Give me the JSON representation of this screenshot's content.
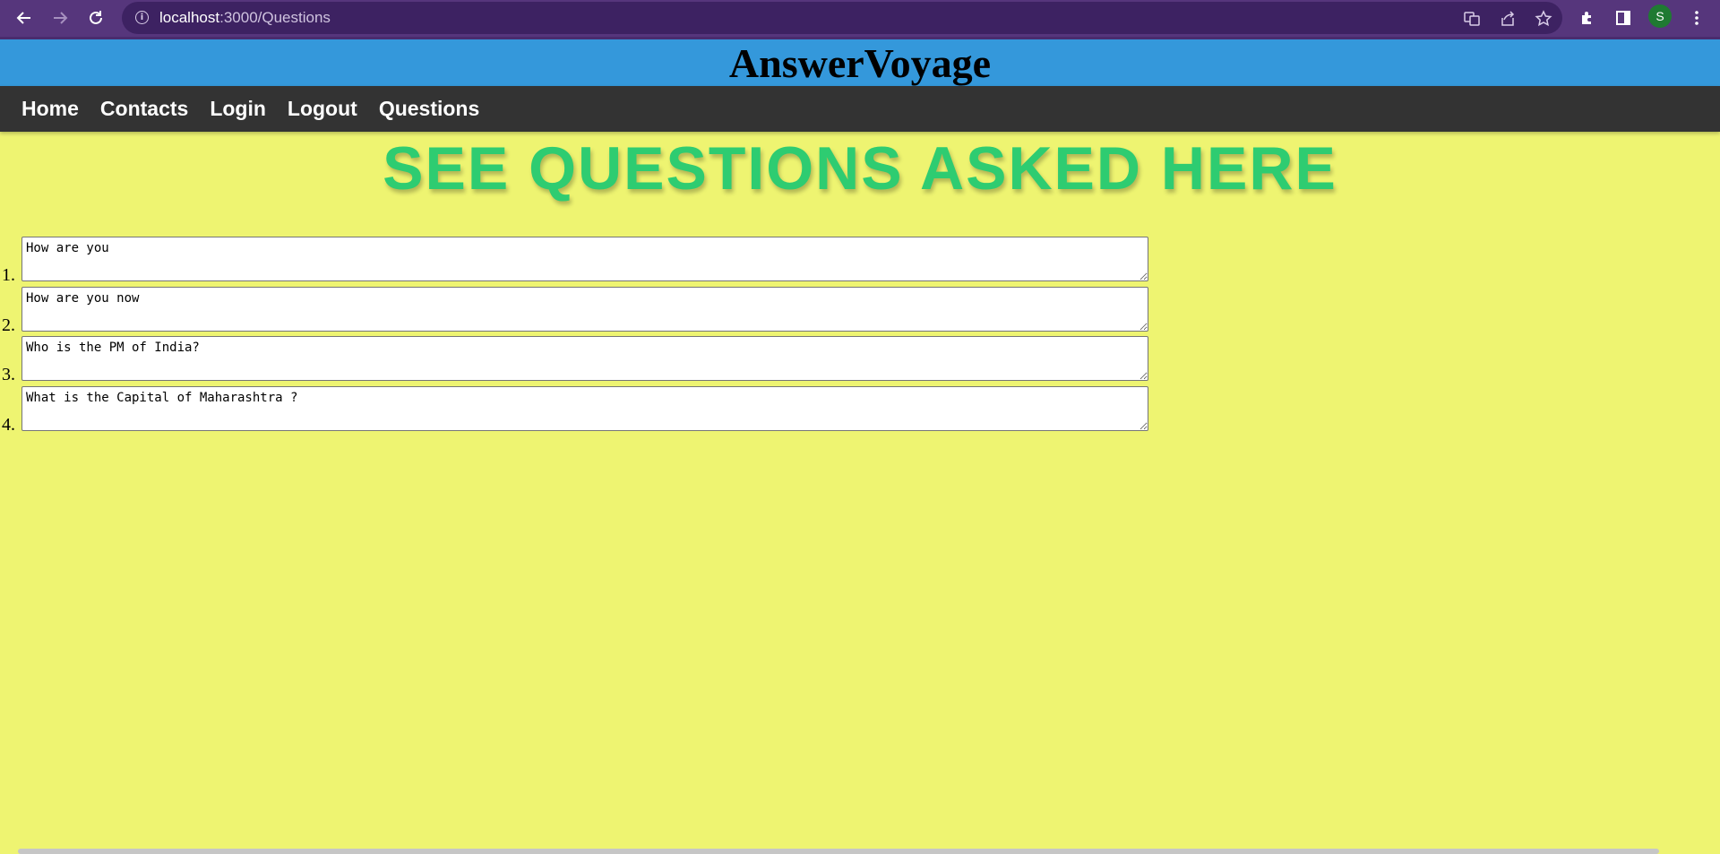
{
  "browser": {
    "url_host": "localhost",
    "url_path": ":3000/Questions",
    "profile_initial": "S",
    "icons": [
      "back-icon",
      "forward-icon",
      "reload-icon",
      "site-info-icon",
      "translate-icon",
      "share-icon",
      "bookmark-star-icon",
      "extensions-icon",
      "side-panel-icon",
      "kebab-menu-icon"
    ]
  },
  "site": {
    "title": "AnswerVoyage",
    "header_color": "#3498db",
    "nav_color": "#333333",
    "page_background": "#eef471",
    "nav": [
      {
        "label": "Home"
      },
      {
        "label": "Contacts"
      },
      {
        "label": "Login"
      },
      {
        "label": "Logout"
      },
      {
        "label": "Questions"
      }
    ]
  },
  "main": {
    "heading": "SEE QUESTIONS ASKED HERE",
    "heading_color": "#2ecc71",
    "questions": [
      {
        "number": "1.",
        "text": "How are you"
      },
      {
        "number": "2.",
        "text": "How are you now"
      },
      {
        "number": "3.",
        "text": "Who is the PM of India?"
      },
      {
        "number": "4.",
        "text": "What is the Capital of Maharashtra ?"
      }
    ]
  }
}
